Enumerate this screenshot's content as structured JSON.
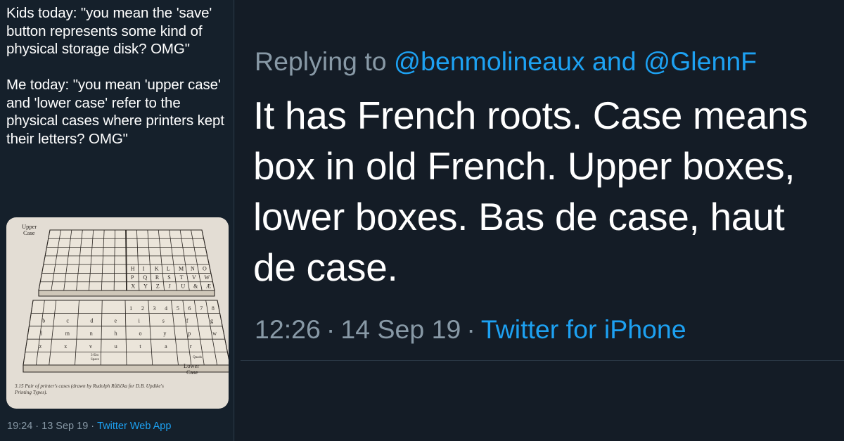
{
  "left_tweet": {
    "text": "Kids today: \"you mean the 'save' button represents some kind of physical storage disk? OMG\"\n\nMe today: \"you mean 'upper case' and 'lower case' refer to the physical cases where printers kept their letters? OMG\"",
    "image": {
      "upper_label": "Upper\nCase",
      "lower_label": "Lower\nCase",
      "space_label": "3-Em\nSpace",
      "quads_label": "Quads",
      "upper_caps_row1": [
        "H",
        "I",
        "K",
        "L",
        "M",
        "N",
        "O"
      ],
      "upper_caps_row2": [
        "P",
        "Q",
        "R",
        "S",
        "T",
        "V",
        "W"
      ],
      "upper_caps_row3": [
        "X",
        "Y",
        "Z",
        "J",
        "U",
        "&",
        "Æ"
      ],
      "lower_figures": [
        "1",
        "2",
        "3",
        "4",
        "5",
        "6",
        "7",
        "8"
      ],
      "lower_letters_row1": [
        "b",
        "c",
        "d",
        "e",
        "i",
        "s",
        "f",
        "g"
      ],
      "lower_letters_row2": [
        "l",
        "m",
        "n",
        "h",
        "o",
        "y",
        "p",
        "w"
      ],
      "lower_letters_row3": [
        "z",
        "x",
        "v",
        "u",
        "t",
        "a",
        "r"
      ],
      "caption": "3.15  Pair of printer's cases (drawn by Rudolph Růžička for D.B. Updike's Printing Types)."
    },
    "time": "19:24",
    "date": "13 Sep 19",
    "source": "Twitter Web App"
  },
  "right_tweet": {
    "replying_prefix": "Replying to",
    "handle_1": "@benmolineaux",
    "conjunction": "and",
    "handle_2": "@GlennF",
    "text": "It has French roots. Case means box in old French. Upper boxes, lower boxes. Bas de case, haut de case.",
    "time": "12:26",
    "date": "14 Sep 19",
    "source": "Twitter for iPhone"
  },
  "separator": "·",
  "colors": {
    "background": "#15202b",
    "text": "#ffffff",
    "muted": "#8899a6",
    "link": "#1da1f2"
  }
}
